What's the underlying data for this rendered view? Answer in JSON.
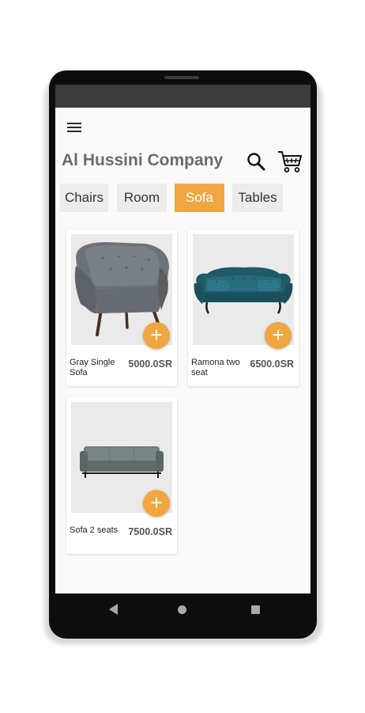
{
  "app": {
    "title": "Al Hussini Company"
  },
  "toolbar": {
    "menu_icon": "menu-icon",
    "search_icon": "search-icon",
    "cart_icon": "cart-icon"
  },
  "tabs": [
    {
      "label": "Chairs",
      "active": false
    },
    {
      "label": "Room",
      "active": false
    },
    {
      "label": "Sofa",
      "active": true
    },
    {
      "label": "Tables",
      "active": false
    }
  ],
  "products": [
    {
      "name": "Gray Single Sofa",
      "price": "5000.0SR",
      "add_label": "+"
    },
    {
      "name": "Ramona two seat",
      "price": "6500.0SR",
      "add_label": "+"
    },
    {
      "name": "Sofa 2 seats",
      "price": "7500.0SR",
      "add_label": "+"
    }
  ],
  "colors": {
    "accent": "#f0a742",
    "title": "#6b6b6b",
    "tab_bg": "#ececec",
    "screen_bg": "#fafafa"
  }
}
